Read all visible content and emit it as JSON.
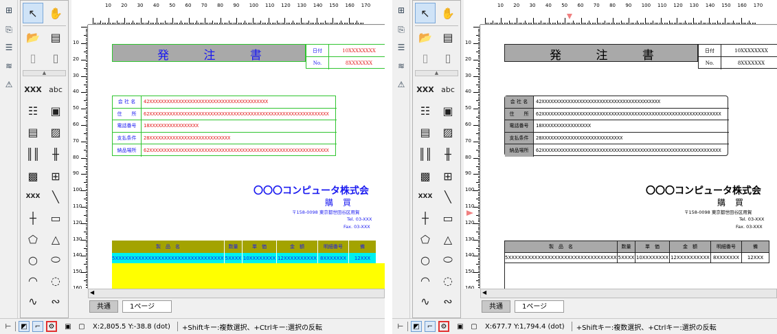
{
  "rulers": {
    "h_labels": [
      "10",
      "20",
      "30",
      "40",
      "50",
      "60",
      "70",
      "80",
      "90",
      "100",
      "110",
      "120",
      "130",
      "140",
      "150",
      "160",
      "170"
    ],
    "v_labels": [
      "10",
      "20",
      "30",
      "40",
      "50",
      "60",
      "70",
      "80",
      "90",
      "100",
      "110",
      "120",
      "130",
      "140",
      "150",
      "160"
    ]
  },
  "form": {
    "title": [
      "発",
      "注",
      "書"
    ],
    "date_label": "日付",
    "date_value": "10XXXXXXXX",
    "no_label": "No.",
    "no_value": "8XXXXXXX",
    "info_rows": [
      {
        "label": "会 社 名",
        "value": "42XXXXXXXXXXXXXXXXXXXXXXXXXXXXXXXXXXXXXXXXX"
      },
      {
        "label": "住　　所",
        "value": "62XXXXXXXXXXXXXXXXXXXXXXXXXXXXXXXXXXXXXXXXXXXXXXXXXXXXXXXXXXXXXX"
      },
      {
        "label": "電話番号",
        "value": "18XXXXXXXXXXXXXXXXX"
      },
      {
        "label": "支払条件",
        "value": "28XXXXXXXXXXXXXXXXXXXXXXXXXXXX"
      },
      {
        "label": "納品場所",
        "value": "62XXXXXXXXXXXXXXXXXXXXXXXXXXXXXXXXXXXXXXXXXXXXXXXXXXXXXXXXXXXXXX"
      }
    ],
    "company": "〇〇〇コンピュータ株式会",
    "kounyu": "購買",
    "address": "〒158-0098 東京都世田谷区用賀",
    "tel": "Tel. 03-XXX",
    "fax": "Fax. 03-XXX",
    "product_headers": [
      "製　品　名",
      "数量",
      "単　価",
      "金　額",
      "明細番号",
      "備"
    ],
    "product_row": [
      "35XXXXXXXXXXXXXXXXXXXXXXXXXXXXXXXXXX",
      "5XXXX",
      "10XXXXXXXX",
      "12XXXXXXXXXX",
      "8XXXXXXX",
      "12XXX"
    ]
  },
  "tabs": {
    "common": "共通",
    "page1": "1ページ"
  },
  "statusA": {
    "coords": "X:2,805.5 Y:-38.8 (dot)",
    "hint": "+Shiftキー:複数選択、+Ctrlキー:選択の反転"
  },
  "statusB": {
    "coords": "X:677.7 Y:1,794.4 (dot)",
    "hint": "+Shiftキー:複数選択、+Ctrlキー:選択の反転"
  },
  "tools": [
    "select-arrow",
    "hand",
    "insert-page",
    "export",
    "copy-page",
    "text-page",
    "text-xxx",
    "text-abc",
    "field-list",
    "field-block",
    "frame-table",
    "image",
    "barcode-1d",
    "barcode-2d",
    "qr-code",
    "link-grid",
    "variable-text",
    "line",
    "cross-line",
    "rectangle",
    "polygon",
    "triangle",
    "circle",
    "ellipse",
    "arc-open",
    "arc-dashed",
    "wave",
    "curve"
  ],
  "colors": {
    "green_border": "#2ec42e",
    "blue_text": "#1a1af0",
    "red_text": "#e21818",
    "olive": "#a3a300",
    "cyan": "#00f0f0",
    "yellow": "#ffff00",
    "gray_fill": "#a9a9a9"
  }
}
